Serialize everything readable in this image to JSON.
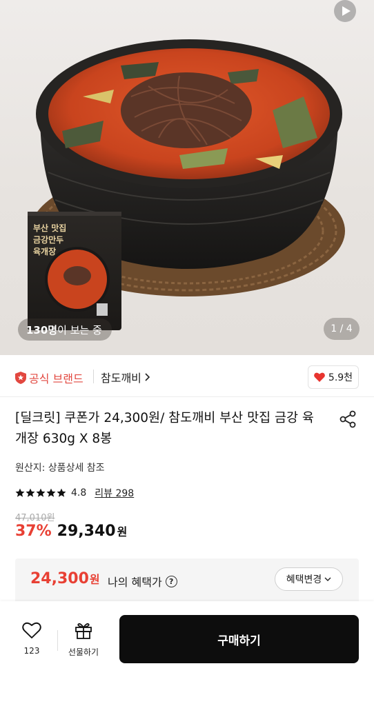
{
  "hero": {
    "viewers_count": "130명",
    "viewers_suffix": "이 보는 중",
    "page_indicator": "1 / 4",
    "package": {
      "line1": "부산 맛집",
      "line2": "금강만두",
      "line3": "육개장"
    }
  },
  "brand": {
    "official_label": "공식 브랜드",
    "name": "참도깨비",
    "likes": "5.9천"
  },
  "product": {
    "title": "[딜크릿] 쿠폰가 24,300원/ 참도깨비 부산 맛집 금강 육개장 630g X 8봉",
    "origin": "원산지: 상품상세 참조",
    "rating": "4.8",
    "rating_stars": 5,
    "review_label": "리뷰 298",
    "original_price": "47,010원",
    "discount": "37%",
    "price": "29,340",
    "price_unit": "원"
  },
  "benefit": {
    "price": "24,300",
    "unit": "원",
    "label": "나의 혜택가",
    "help": "?",
    "change_label": "혜택변경"
  },
  "bottom": {
    "wish_count": "123",
    "gift_label": "선물하기",
    "buy_label": "구매하기"
  },
  "colors": {
    "accent_red": "#e84034",
    "buy_button": "#0d0d0d"
  }
}
